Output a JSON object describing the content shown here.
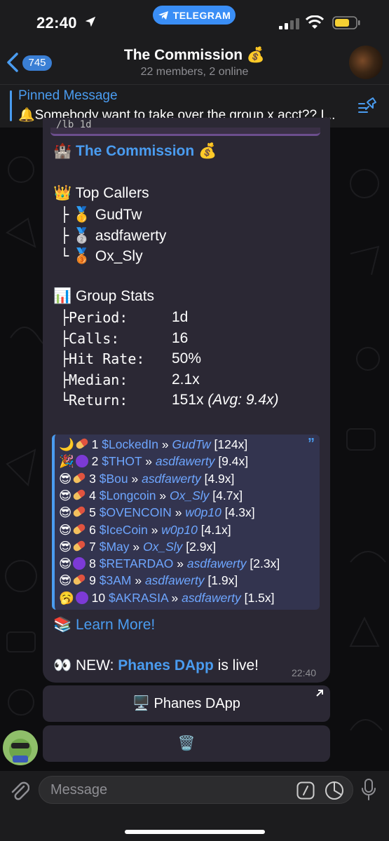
{
  "status": {
    "time": "22:40",
    "app_pill": "TELEGRAM"
  },
  "header": {
    "back_count": "745",
    "title": "The Commission 💰",
    "subtitle": "22 members, 2 online"
  },
  "pinned": {
    "title": "Pinned Message",
    "text": "🔔Somebody want to take over the group x acct?? I..."
  },
  "message": {
    "quoted_fragment": "/lb 1d",
    "group_title_emoji": "🏰",
    "group_title": "The Commission",
    "group_title_suffix": "💰",
    "top_callers_heading": "👑 Top Callers",
    "top_callers": [
      {
        "prefix": "├",
        "medal": "🥇",
        "name": "GudTw"
      },
      {
        "prefix": "├",
        "medal": "🥈",
        "name": "asdfawerty"
      },
      {
        "prefix": "└",
        "medal": "🥉",
        "name": "Ox_Sly"
      }
    ],
    "stats_heading": "📊 Group Stats",
    "stats": [
      {
        "label": "├Period:",
        "value": "1d",
        "extra": ""
      },
      {
        "label": "├Calls:",
        "value": "16",
        "extra": ""
      },
      {
        "label": "├Hit Rate:",
        "value": "50%",
        "extra": ""
      },
      {
        "label": "├Median:",
        "value": "2.1x",
        "extra": ""
      },
      {
        "label": "└Return:",
        "value": "151x",
        "extra": "(Avg: 9.4x)"
      }
    ],
    "leaderboard": [
      {
        "icon": "🌙",
        "chain": "pill",
        "rank": "1",
        "ticker": "$LockedIn",
        "sep": "»",
        "caller": "GudTw",
        "mult": "[124x]"
      },
      {
        "icon": "🎉",
        "chain": "circle",
        "rank": "2",
        "ticker": "$THOT",
        "sep": "»",
        "caller": "asdfawerty",
        "mult": "[9.4x]"
      },
      {
        "icon": "😎",
        "chain": "pill",
        "rank": "3",
        "ticker": "$Bou",
        "sep": "»",
        "caller": "asdfawerty",
        "mult": "[4.9x]"
      },
      {
        "icon": "😎",
        "chain": "pill",
        "rank": "4",
        "ticker": "$Longcoin",
        "sep": "»",
        "caller": "Ox_Sly",
        "mult": "[4.7x]"
      },
      {
        "icon": "😎",
        "chain": "pill",
        "rank": "5",
        "ticker": "$OVENCOIN",
        "sep": "»",
        "caller": "w0p10",
        "mult": "[4.3x]"
      },
      {
        "icon": "😎",
        "chain": "pill",
        "rank": "6",
        "ticker": "$IceCoin",
        "sep": "»",
        "caller": "w0p10",
        "mult": "[4.1x]"
      },
      {
        "icon": "😎",
        "chain": "pill",
        "rank": "7",
        "ticker": "$May",
        "sep": "»",
        "caller": "Ox_Sly",
        "mult": "[2.9x]"
      },
      {
        "icon": "😎",
        "chain": "circle",
        "rank": "8",
        "ticker": "$RETARDAO",
        "sep": "»",
        "caller": "asdfawerty",
        "mult": "[2.3x]"
      },
      {
        "icon": "😎",
        "chain": "pill",
        "rank": "9",
        "ticker": "$3AM",
        "sep": "»",
        "caller": "asdfawerty",
        "mult": "[1.9x]"
      },
      {
        "icon": "🥱",
        "chain": "circle",
        "rank": "10",
        "ticker": "$AKRASIA",
        "sep": "»",
        "caller": "asdfawerty",
        "mult": "[1.5x]"
      }
    ],
    "learn_more_emoji": "📚",
    "learn_more": "Learn More!",
    "new_prefix": "👀 NEW:",
    "new_link": "Phanes DApp",
    "new_suffix": "is live!",
    "time": "22:40"
  },
  "buttons": {
    "dapp": "🖥️ Phanes DApp",
    "delete": "🗑️"
  },
  "input": {
    "placeholder": "Message"
  },
  "colors": {
    "accent": "#4a9cf0",
    "bubble": "#2b2834",
    "pill": "#3a8ef6"
  }
}
